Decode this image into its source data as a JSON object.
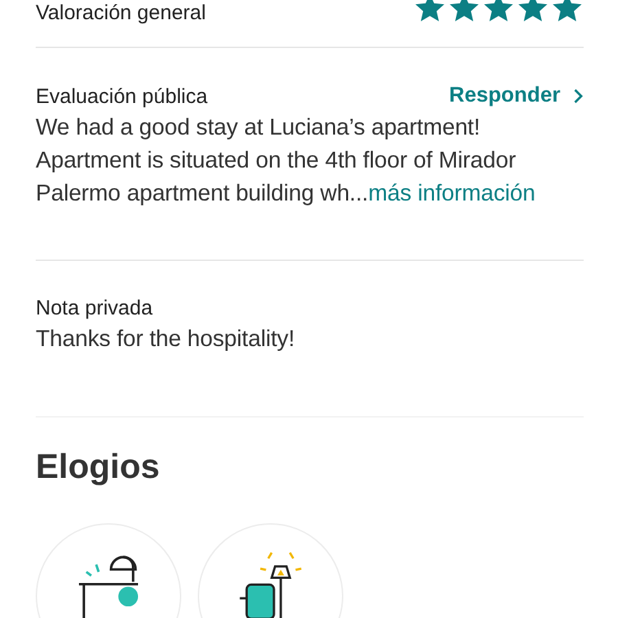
{
  "overall_rating": {
    "label": "Valoración general",
    "stars": 5
  },
  "public_review": {
    "label": "Evaluación pública",
    "reply_link": "Responder",
    "text": "We had a good stay at Luciana’s apartment! Apartment is situated on the 4th floor of Mirador Palermo apartment building wh...",
    "more_link": "más información"
  },
  "private_note": {
    "label": "Nota privada",
    "text": "Thanks for the hospitality!"
  },
  "compliments": {
    "title": "Elogios",
    "items": [
      {
        "kind": "bathroom"
      },
      {
        "kind": "living-room"
      }
    ]
  }
}
